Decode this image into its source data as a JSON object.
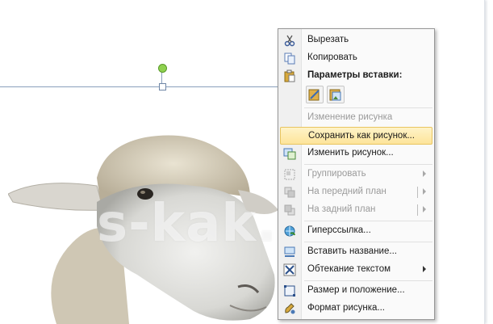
{
  "watermark": "s-kak.ru",
  "context_menu": {
    "items": [
      {
        "label": "Вырезать",
        "icon": "scissors-icon",
        "enabled": true
      },
      {
        "label": "Копировать",
        "icon": "copy-icon",
        "enabled": true
      },
      {
        "label": "Параметры вставки:",
        "icon": "paste-icon",
        "enabled": true,
        "header": true
      },
      {
        "label": "Изменение рисунка",
        "enabled": false
      },
      {
        "label": "Сохранить как рисунок...",
        "enabled": true,
        "highlighted": true
      },
      {
        "label": "Изменить рисунок...",
        "icon": "change-picture-icon",
        "enabled": true
      },
      {
        "label": "Группировать",
        "icon": "group-icon",
        "enabled": false,
        "submenu": true
      },
      {
        "label": "На передний план",
        "icon": "bring-forward-icon",
        "enabled": false,
        "submenu": true
      },
      {
        "label": "На задний план",
        "icon": "send-backward-icon",
        "enabled": false,
        "submenu": true
      },
      {
        "label": "Гиперссылка...",
        "icon": "hyperlink-icon",
        "enabled": true
      },
      {
        "label": "Вставить название...",
        "icon": "insert-caption-icon",
        "enabled": true
      },
      {
        "label": "Обтекание текстом",
        "icon": "text-wrap-icon",
        "enabled": true,
        "submenu": true
      },
      {
        "label": "Размер и положение...",
        "icon": "size-position-icon",
        "enabled": true
      },
      {
        "label": "Формат рисунка...",
        "icon": "format-picture-icon",
        "enabled": true
      }
    ],
    "paste_options": [
      "keep-source-formatting-icon",
      "picture-paste-icon"
    ]
  },
  "colors": {
    "highlight": "#fde49a",
    "rotate_handle": "#8fd14f",
    "selection": "#8aa0bd"
  }
}
